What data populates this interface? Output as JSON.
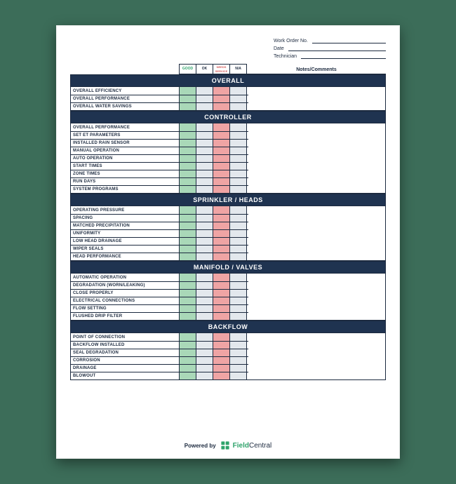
{
  "header": {
    "work_order_label": "Work Order No.",
    "date_label": "Date",
    "technician_label": "Technician"
  },
  "legend": {
    "good": "GOOD",
    "ok": "OK",
    "needs": "NEEDS SERVICE",
    "na": "N/A"
  },
  "notes_header": "Notes/Comments",
  "sections": [
    {
      "title": "OVERALL",
      "items": [
        "OVERALL EFFICIENCY",
        "OVERALL PERFORMANCE",
        "OVERALL WATER SAVINGS"
      ]
    },
    {
      "title": "CONTROLLER",
      "items": [
        "OVERALL PERFORMANCE",
        "SET ET PARAMETERS",
        "INSTALLED RAIN SENSOR",
        "MANUAL OPERATION",
        "AUTO OPERATION",
        "START TIMES",
        "ZONE TIMES",
        "RUN DAYS",
        "SYSTEM PROGRAMS"
      ]
    },
    {
      "title": "SPRINKLER / HEADS",
      "items": [
        "OPERATING PRESSURE",
        "SPACING",
        "MATCHED PRECIPITATION",
        "UNIFORMITY",
        "LOW HEAD DRAINAGE",
        "WIPER SEALS",
        "HEAD PERFORMANCE"
      ]
    },
    {
      "title": "MANIFOLD / VALVES",
      "items": [
        "AUTOMATIC OPERATION",
        "DEGRADATION (WORN/LEAKING)",
        "CLOSE PROPERLY",
        "ELECTRICAL CONNECTIONS",
        "FLOW SETTING",
        "FLUSHED DRIP FILTER"
      ]
    },
    {
      "title": "BACKFLOW",
      "items": [
        "POINT OF CONNECTION",
        "BACKFLOW INSTALLED",
        "SEAL DEGRADATION",
        "CORROSION",
        "DRAINAGE",
        "BLOWOUT"
      ]
    }
  ],
  "footer": {
    "powered_by": "Powered by",
    "brand_a": "Field",
    "brand_b": "Central"
  }
}
